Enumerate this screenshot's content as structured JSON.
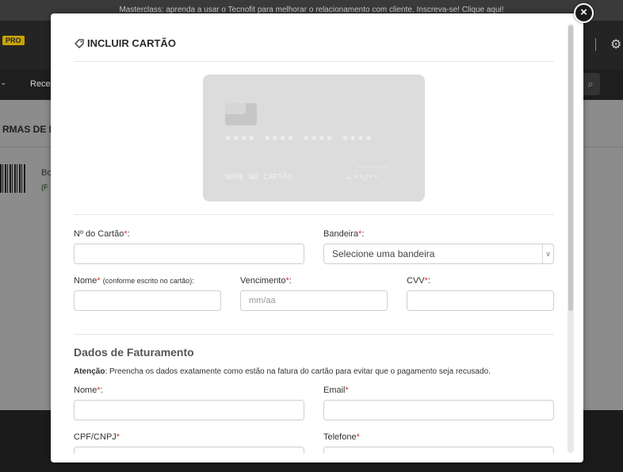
{
  "background": {
    "banner": "Masterclass: aprenda a usar o Tecnofit para melhorar o relacionamento com cliente. Inscreva-se! Clique aqui!",
    "pro_badge": "PRO",
    "nav_item": "Rece",
    "page_title": "RMAS DE PA",
    "row_text": "Bo",
    "row_sub": "(F"
  },
  "modal": {
    "title": "INCLUIR CARTÃO",
    "close_label": "×",
    "card_preview": {
      "number": "**** **** **** ****",
      "name": "NOME NO CARTÃO",
      "expiry": "**/**"
    },
    "card_number": {
      "label": "Nº do Cartão",
      "value": ""
    },
    "brand": {
      "label": "Bandeira",
      "selected": "Selecione uma bandeira"
    },
    "name": {
      "label": "Nome",
      "hint": "(conforme escrito no cartão):",
      "value": ""
    },
    "expiry": {
      "label": "Vencimento",
      "placeholder": "mm/aa"
    },
    "cvv": {
      "label": "CVV",
      "value": ""
    },
    "billing": {
      "title": "Dados de Faturamento",
      "attention_label": "Atenção",
      "attention_text": ": Preencha os dados exatamente como estão na fatura do cartão para evitar que o pagamento seja recusado.",
      "name_label": "Nome",
      "email_label": "Email",
      "doc_label": "CPF/CNPJ",
      "phone_label": "Telefone"
    },
    "required_mark": "*"
  },
  "colors": {
    "required": "#d9322b",
    "overlay": "#8c8c8c"
  }
}
